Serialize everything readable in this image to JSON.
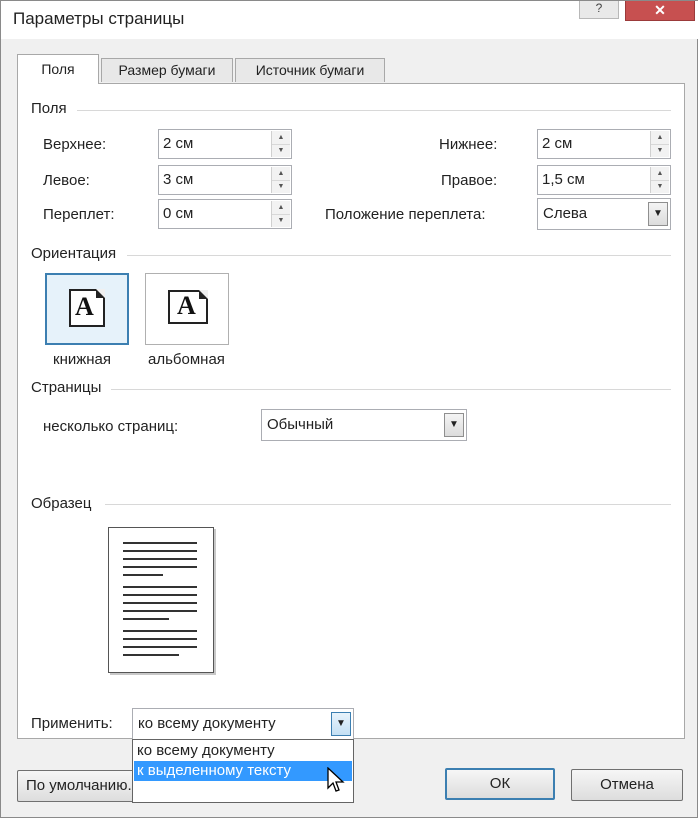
{
  "window": {
    "title": "Параметры страницы",
    "help_glyph": "?",
    "close_glyph": "✕",
    "close_color": "#c75050"
  },
  "tabs": [
    {
      "label": "Поля",
      "active": true
    },
    {
      "label": "Размер бумаги",
      "active": false
    },
    {
      "label": "Источник бумаги",
      "active": false
    }
  ],
  "margins": {
    "group_label": "Поля",
    "top_label": "Верхнее:",
    "top_value": "2 см",
    "bottom_label": "Нижнее:",
    "bottom_value": "2 см",
    "left_label": "Левое:",
    "left_value": "3 см",
    "right_label": "Правое:",
    "right_value": "1,5 см",
    "gutter_label": "Переплет:",
    "gutter_value": "0 см",
    "gutter_position_label": "Положение переплета:",
    "gutter_position_value": "Слева"
  },
  "orientation": {
    "group_label": "Ориентация",
    "portrait_label": "книжная",
    "landscape_label": "альбомная",
    "icon_letter": "A",
    "selected": "книжная"
  },
  "pages": {
    "group_label": "Страницы",
    "multiple_label": "несколько страниц:",
    "multiple_value": "Обычный"
  },
  "preview": {
    "group_label": "Образец"
  },
  "apply": {
    "label": "Применить:",
    "value": "ко всему документу",
    "options": [
      "ко всему документу",
      "к выделенному тексту"
    ],
    "highlighted_option": "к выделенному тексту"
  },
  "buttons": {
    "default_label": "По умолчанию...",
    "ok_label": "ОК",
    "cancel_label": "Отмена"
  },
  "colors": {
    "accent": "#3c7fb1",
    "highlight": "#3399ff"
  }
}
